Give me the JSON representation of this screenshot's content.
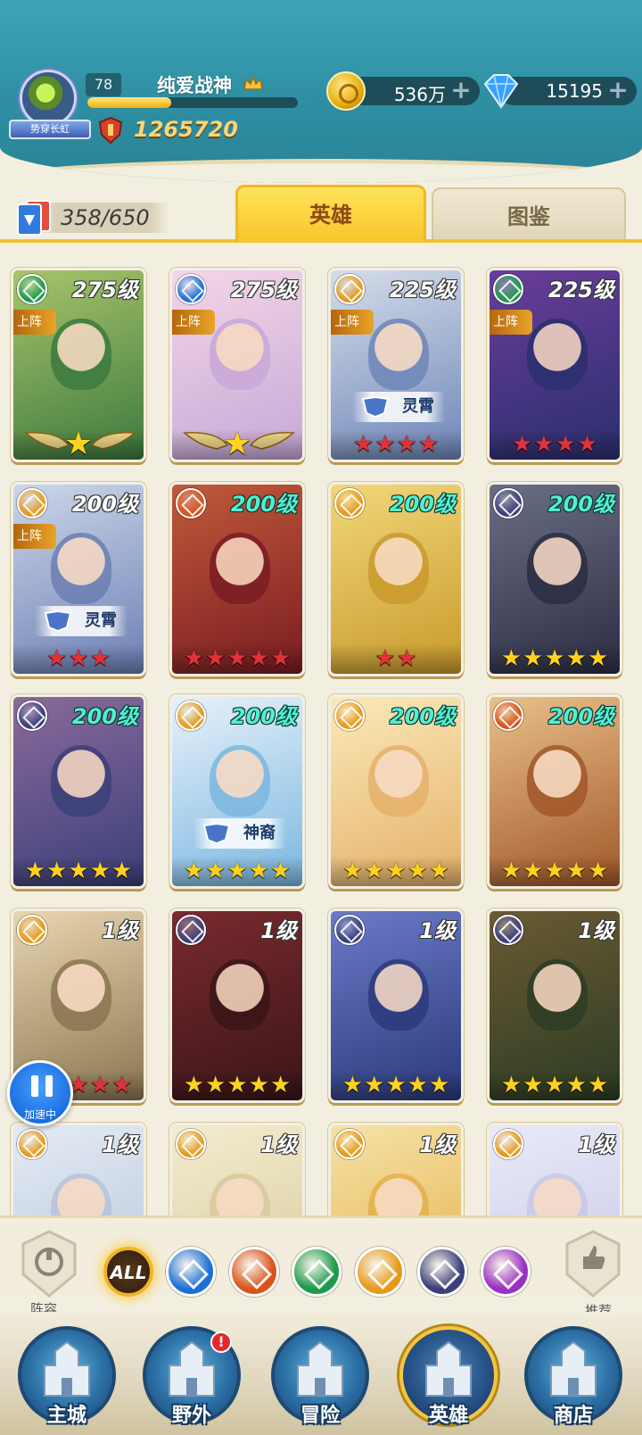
{
  "header": {
    "avatar_badge": "势穿长虹",
    "level": "78",
    "player_name": "纯爱战神",
    "combat_power": "1265720",
    "exp_fraction": 0.4,
    "gold": "536万",
    "diamonds": "15195"
  },
  "tabs": {
    "card_count": "358/650",
    "heroes": "英雄",
    "codex": "图鉴"
  },
  "heroes": [
    {
      "level": "275级",
      "deployed": "上阵",
      "faction": "wind",
      "stars": 1,
      "star_color": "gold",
      "winged": true,
      "tag": ""
    },
    {
      "level": "275级",
      "deployed": "上阵",
      "faction": "water",
      "stars": 1,
      "star_color": "gold",
      "winged": true,
      "tag": ""
    },
    {
      "level": "225级",
      "deployed": "上阵",
      "faction": "light",
      "stars": 4,
      "star_color": "red",
      "winged": false,
      "tag": "灵霄"
    },
    {
      "level": "225级",
      "deployed": "上阵",
      "faction": "wind",
      "stars": 4,
      "star_color": "red",
      "winged": false,
      "tag": ""
    },
    {
      "level": "200级",
      "deployed": "上阵",
      "faction": "light",
      "stars": 3,
      "star_color": "red",
      "winged": false,
      "tag": "灵霄"
    },
    {
      "level": "200级",
      "deployed": "",
      "faction": "fire",
      "stars": 5,
      "star_color": "red",
      "winged": false,
      "tag": ""
    },
    {
      "level": "200级",
      "deployed": "",
      "faction": "light",
      "stars": 2,
      "star_color": "red",
      "winged": false,
      "tag": ""
    },
    {
      "level": "200级",
      "deployed": "",
      "faction": "dark",
      "stars": 5,
      "star_color": "gold",
      "winged": false,
      "tag": ""
    },
    {
      "level": "200级",
      "deployed": "",
      "faction": "dark",
      "stars": 5,
      "star_color": "gold",
      "winged": false,
      "tag": ""
    },
    {
      "level": "200级",
      "deployed": "",
      "faction": "light",
      "stars": 5,
      "star_color": "gold",
      "winged": false,
      "tag": "神裔"
    },
    {
      "level": "200级",
      "deployed": "",
      "faction": "light",
      "stars": 5,
      "star_color": "gold",
      "winged": false,
      "tag": ""
    },
    {
      "level": "200级",
      "deployed": "",
      "faction": "fire",
      "stars": 5,
      "star_color": "gold",
      "winged": false,
      "tag": ""
    },
    {
      "level": "1级",
      "deployed": "",
      "faction": "light",
      "stars": 5,
      "star_color": "red",
      "winged": false,
      "tag": ""
    },
    {
      "level": "1级",
      "deployed": "",
      "faction": "dark",
      "stars": 5,
      "star_color": "gold",
      "winged": false,
      "tag": ""
    },
    {
      "level": "1级",
      "deployed": "",
      "faction": "dark",
      "stars": 5,
      "star_color": "gold",
      "winged": false,
      "tag": ""
    },
    {
      "level": "1级",
      "deployed": "",
      "faction": "dark",
      "stars": 5,
      "star_color": "gold",
      "winged": false,
      "tag": ""
    },
    {
      "level": "1级",
      "deployed": "",
      "faction": "light",
      "stars": 0,
      "star_color": "gold",
      "winged": false,
      "tag": ""
    },
    {
      "level": "1级",
      "deployed": "",
      "faction": "light",
      "stars": 0,
      "star_color": "gold",
      "winged": false,
      "tag": ""
    },
    {
      "level": "1级",
      "deployed": "",
      "faction": "light",
      "stars": 0,
      "star_color": "gold",
      "winged": false,
      "tag": ""
    },
    {
      "level": "1级",
      "deployed": "",
      "faction": "light",
      "stars": 0,
      "star_color": "gold",
      "winged": false,
      "tag": ""
    }
  ],
  "speed_up": {
    "label": "加速中"
  },
  "filters": {
    "all_label": "ALL",
    "lineup_label": "阵容",
    "recommend_label": "推荐",
    "factions": [
      "water",
      "fire",
      "wind",
      "light",
      "dark",
      "arcane"
    ]
  },
  "faction_colors": {
    "water": "#1d6fd8",
    "fire": "#d9531b",
    "wind": "#1d9a4a",
    "light": "#e59a1a",
    "dark": "#3d3f7a",
    "arcane": "#9a2fc2"
  },
  "bottom_nav": {
    "items": [
      "主城",
      "野外",
      "冒险",
      "英雄",
      "商店"
    ],
    "active_index": 3,
    "notification": "!"
  }
}
